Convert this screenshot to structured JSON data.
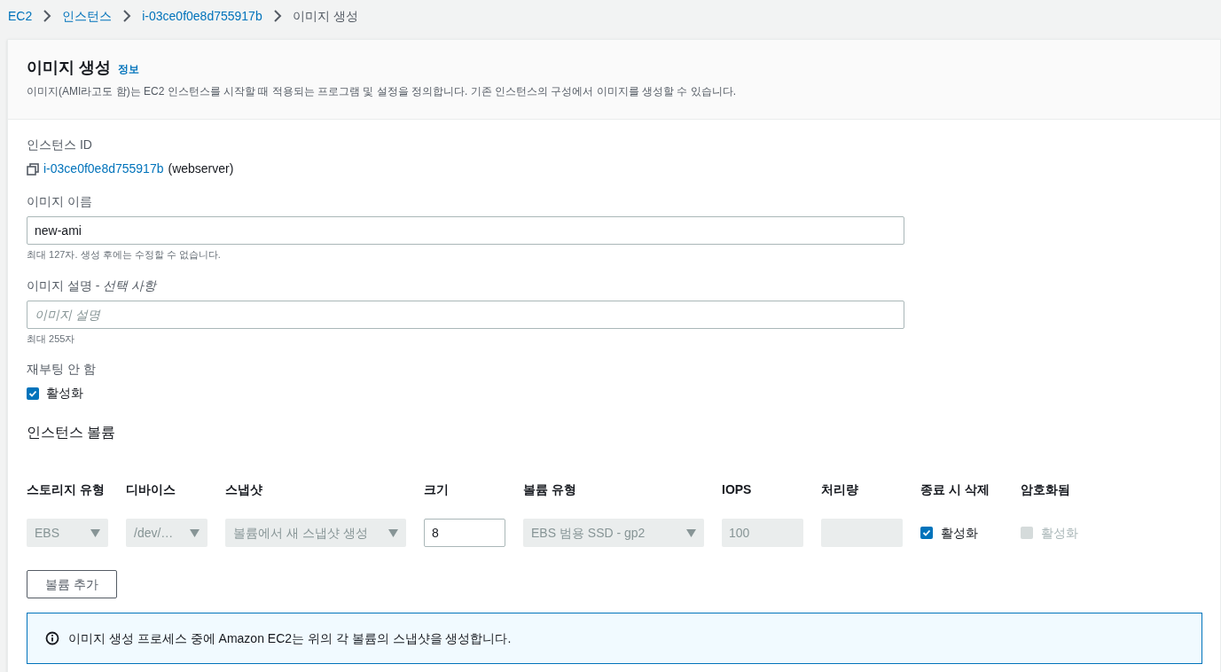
{
  "breadcrumb": [
    {
      "label": "EC2",
      "kind": "link"
    },
    {
      "label": "인스턴스",
      "kind": "link"
    },
    {
      "label": "i-03ce0f0e8d755917b",
      "kind": "link"
    },
    {
      "label": "이미지 생성",
      "kind": "current"
    }
  ],
  "header": {
    "title": "이미지 생성",
    "info_link": "정보",
    "description": "이미지(AMI라고도 함)는 EC2 인스턴스를 시작할 때 적용되는 프로그램 및 설정을 정의합니다. 기존 인스턴스의 구성에서 이미지를 생성할 수 있습니다."
  },
  "instance_id": {
    "label": "인스턴스 ID",
    "link": "i-03ce0f0e8d755917b",
    "suffix": "(webserver)"
  },
  "image_name": {
    "label": "이미지 이름",
    "value": "new-ami",
    "hint": "최대 127자. 생성 후에는 수정할 수 없습니다."
  },
  "image_description": {
    "label": "이미지 설명 - ",
    "label_optional": "선택 사항",
    "placeholder": "이미지 설명",
    "hint": "최대 255자"
  },
  "no_reboot": {
    "label": "재부팅 안 함",
    "checkbox": {
      "label": "활성화",
      "checked": true
    }
  },
  "volumes": {
    "title": "인스턴스 볼륨",
    "columns": [
      "스토리지 유형",
      "디바이스",
      "스냅샷",
      "크기",
      "볼륨 유형",
      "IOPS",
      "처리량",
      "종료 시 삭제",
      "암호화됨"
    ],
    "rows": [
      {
        "cells": [
          {
            "kind": "select",
            "value": "EBS",
            "disabled": true
          },
          {
            "kind": "select",
            "value": "/dev/…",
            "disabled": true
          },
          {
            "kind": "select",
            "value": "볼륨에서 새 스냅샷 생성",
            "disabled": true
          },
          {
            "kind": "input",
            "value": "8",
            "disabled": false
          },
          {
            "kind": "select",
            "value": "EBS 범용 SSD - gp2",
            "disabled": true
          },
          {
            "kind": "input",
            "value": "100",
            "disabled": true
          },
          {
            "kind": "input",
            "disabled": true
          },
          {
            "kind": "checkbox",
            "label": "활성화",
            "checked": true,
            "disabled": false
          },
          {
            "kind": "checkbox",
            "label": "활성화",
            "checked": false,
            "disabled": true
          }
        ]
      }
    ]
  },
  "add_volume_button": "볼륨 추가",
  "info_alert": "이미지 생성 프로세스 중에 Amazon EC2는 위의 각 볼륨의 스냅샷을 생성합니다."
}
